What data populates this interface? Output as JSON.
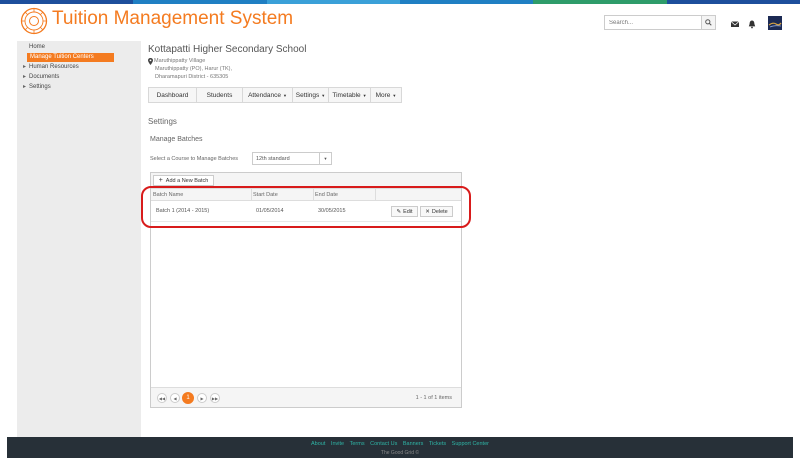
{
  "colors": {
    "accent": "#f47b20",
    "highlight": "#d81b1b",
    "footer_bg": "#273038",
    "footer_link": "#2eb5a6"
  },
  "header": {
    "app_title": "Tuition Management System",
    "search_placeholder": "Search...",
    "icons": [
      "search-icon",
      "mail-icon",
      "bell-icon"
    ]
  },
  "sidebar": {
    "home": "Home",
    "active": "Manage Tuition Centers",
    "items": [
      {
        "label": "Human Resources"
      },
      {
        "label": "Documents"
      },
      {
        "label": "Settings"
      }
    ]
  },
  "school": {
    "name": "Kottapatti Higher Secondary School",
    "address": [
      "Maruthippatty Village",
      "Maruthippatty (PO), Harur (TK),",
      "Dharamapuri District - 635305"
    ]
  },
  "nav": [
    {
      "label": "Dashboard",
      "dropdown": false
    },
    {
      "label": "Students",
      "dropdown": false
    },
    {
      "label": "Attendance",
      "dropdown": true
    },
    {
      "label": "Settings",
      "dropdown": true
    },
    {
      "label": "Timetable",
      "dropdown": true
    },
    {
      "label": "More",
      "dropdown": true
    }
  ],
  "page": {
    "heading": "Settings",
    "subheading": "Manage Batches",
    "course_label": "Select a Course to Manage Batches",
    "course_selected": "12th standard"
  },
  "grid": {
    "add_button": "Add a New Batch",
    "columns": [
      "Batch Name",
      "Start Date",
      "End Date"
    ],
    "rows": [
      {
        "name": "Batch 1 (2014 - 2015)",
        "start": "01/05/2014",
        "end": "30/05/2015"
      }
    ],
    "edit_label": "Edit",
    "delete_label": "Delete",
    "current_page": "1",
    "pager_info": "1 - 1 of 1 items"
  },
  "footer": {
    "links": [
      "About",
      "Invite",
      "Terms",
      "Contact Us",
      "Banners",
      "Tickets",
      "Support Center"
    ],
    "copyright": "The Good Grid ©"
  }
}
